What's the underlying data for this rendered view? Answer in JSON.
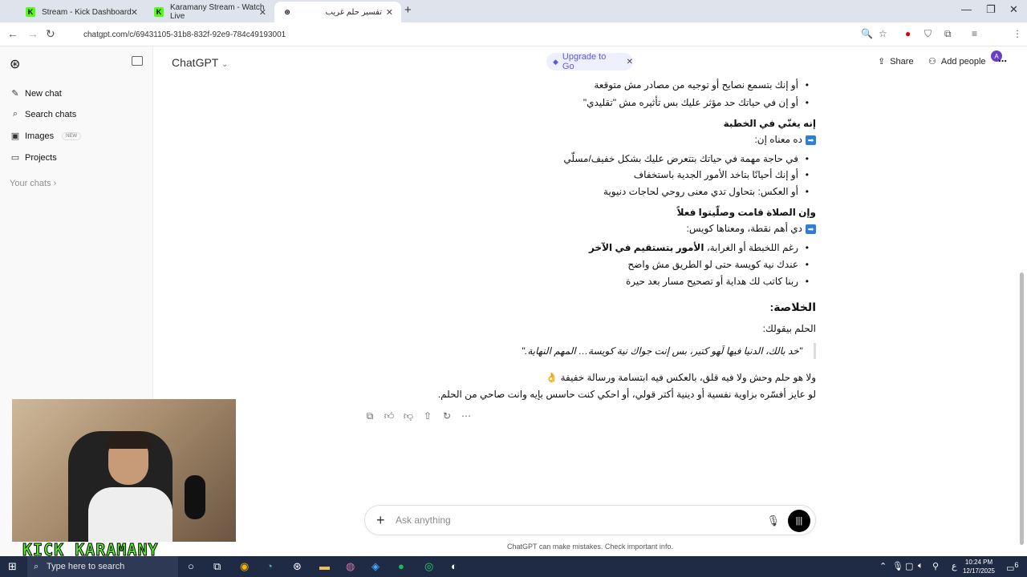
{
  "browser": {
    "tabs": [
      {
        "title": "Stream - Kick Dashboard"
      },
      {
        "title": "Karamany Stream - Watch Live"
      },
      {
        "title": "تفسير حلم غريب"
      }
    ],
    "url": "chatgpt.com/c/69431105-31b8-832f-92e9-784c49193001",
    "profile_initial": "A"
  },
  "sidebar": {
    "items": [
      {
        "label": "New chat",
        "icon": "pencil-icon"
      },
      {
        "label": "Search chats",
        "icon": "search-icon"
      },
      {
        "label": "Images",
        "icon": "image-icon",
        "badge": "NEW"
      },
      {
        "label": "Projects",
        "icon": "folder-icon"
      }
    ],
    "section": "Your chats"
  },
  "header": {
    "title": "ChatGPT",
    "upgrade": "Upgrade to Go",
    "share": "Share",
    "add_people": "Add people"
  },
  "chat": {
    "l1": "أو إنك بتسمع نصايح أو توجيه من مصادر مش متوقعة",
    "l2": "أو إن في حياتك حد مؤثر عليك بس تأثيره مش \"تقليدي\"",
    "h1": "إنه يغنّي في الخطبة",
    "m1": "ده معناه إن:",
    "l3": "في حاجة مهمة في حياتك بتتعرض عليك بشكل خفيف/مسلّي",
    "l4": "أو إنك أحيانًا بتاخد الأمور الجدية باستخفاف",
    "l5": "أو العكس: بتحاول تدي معنى روحي لحاجات دنيوية",
    "h2": "وإن الصلاة قامت وصلّيتوا فعلاً",
    "m2": "دي أهم نقطة، ومعناها كويس:",
    "l6a": "رغم اللخبطة أو الغرابة، ",
    "l6b": "الأمور بتستقيم في الآخر",
    "l7": "عندك نية كويسة حتى لو الطريق مش واضح",
    "l8": "ربنا كاتب لك هداية أو تصحيح مسار بعد حيرة",
    "summary_title": "الخلاصة:",
    "summary_intro": "الحلم بيقولك:",
    "quote": "\"خد بالك، الدنيا فيها لَهو كتير، بس إنت جواك نية كويسة… المهم النهاية.\"",
    "p1": "ولا هو حلم وحش ولا فيه قلق، بالعكس فيه ابتسامة ورسالة خفيفة 👌",
    "p2": "لو عايز أفسّره بزاوية نفسية أو دينية أكتر قولي، أو احكي كنت حاسس بإيه وانت صاحي من الحلم."
  },
  "composer": {
    "placeholder": "Ask anything",
    "disclaimer": "ChatGPT can make mistakes. Check important info."
  },
  "overlay": {
    "logo_text": "KICK KARAMANY"
  },
  "taskbar": {
    "search": "Type here to search",
    "time": "10:24 PM",
    "date": "12/17/2025",
    "lang": "ع",
    "notif": "6"
  }
}
